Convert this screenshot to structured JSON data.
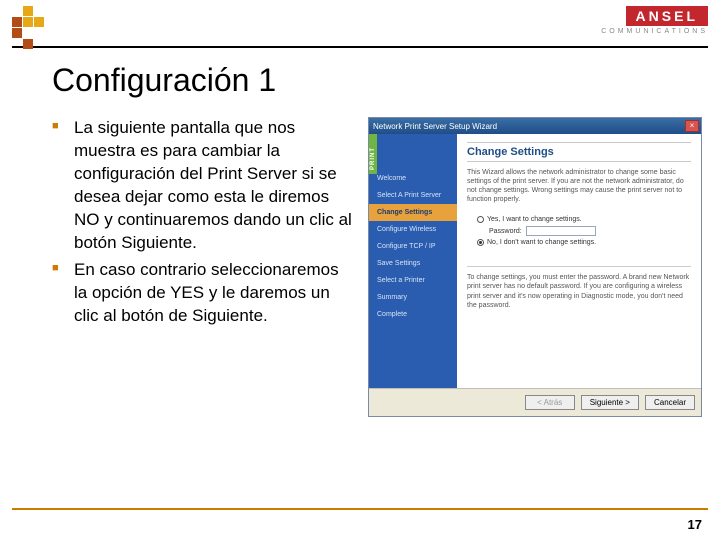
{
  "brand": {
    "name": "ANSEL",
    "sub": "COMMUNICATIONS"
  },
  "title": "Configuración 1",
  "bullets": [
    "La siguiente pantalla que nos muestra es para cambiar la configuración del Print Server si se desea dejar como esta le diremos NO y continuaremos dando un clic al botón Siguiente.",
    "En caso contrario seleccionaremos la opción de YES y le daremos un clic al botón de Siguiente."
  ],
  "wizard": {
    "titlebar": "Network Print Server Setup Wizard",
    "sidetag": "PRINT",
    "steps": [
      "Welcome",
      "Select A Print Server",
      "Change Settings",
      "Configure Wireless",
      "Configure TCP / IP",
      "Save Settings",
      "Select a Printer",
      "Summary",
      "Complete"
    ],
    "active_step_index": 2,
    "panel_title": "Change Settings",
    "panel_desc": "This Wizard allows the network administrator to change some basic settings of the print server. If you are not the network administrator, do not change settings. Wrong settings may cause the print server not to function properly.",
    "opt_yes": "Yes, I want to change settings.",
    "pw_label": "Password:",
    "opt_no": "No, I don't want to change settings.",
    "note": "To change settings, you must enter the password. A brand new Network print server has no default password. If you are configuring a wireless print server and it's now operating in Diagnostic mode, you don't need the password.",
    "buttons": {
      "back": "< Atrás",
      "next": "Siguiente >",
      "cancel": "Cancelar"
    }
  },
  "page_number": "17",
  "logo_colors": [
    "",
    "#e6a817",
    "",
    "",
    "#b34d17",
    "#e6a817",
    "#e6a817",
    "",
    "#b34d17",
    "",
    "",
    "",
    "",
    "#b34d17",
    "",
    ""
  ]
}
